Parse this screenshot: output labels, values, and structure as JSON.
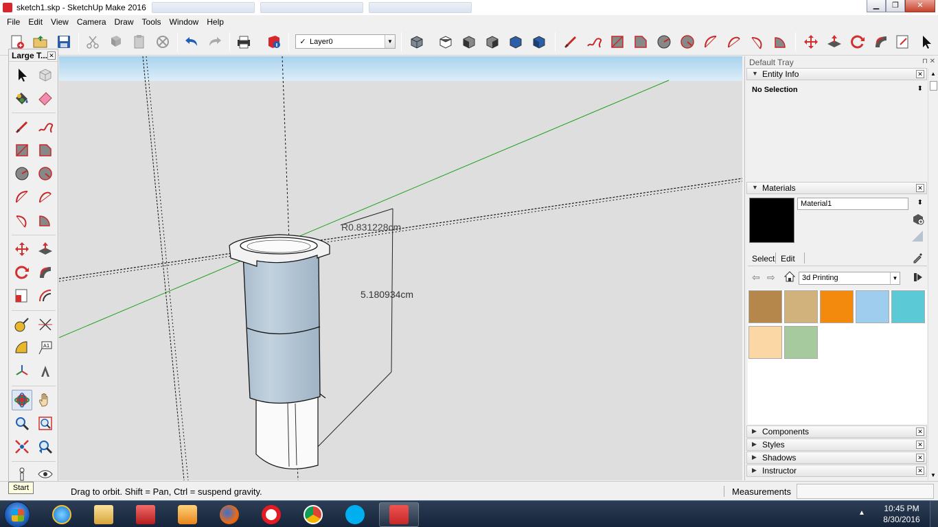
{
  "window": {
    "title": "sketch1.skp - SketchUp Make 2016",
    "buttons": {
      "minimize": "▁",
      "maximize": "❐",
      "close": "✕"
    }
  },
  "menu": [
    "File",
    "Edit",
    "View",
    "Camera",
    "Draw",
    "Tools",
    "Window",
    "Help"
  ],
  "toolbar": {
    "layer": {
      "check": "✓",
      "value": "Layer0"
    }
  },
  "palette": {
    "title": "Large T...",
    "close": "✕"
  },
  "viewport": {
    "dim_radius": "R0.831228cm",
    "dim_height": "5.180934cm",
    "colors": {
      "sky": "#cce6f7",
      "ground": "#dedede",
      "body": "#b7c7d6",
      "axis_green": "#1aa01a"
    }
  },
  "tray": {
    "title": "Default Tray",
    "pin": "⊓ ✕",
    "entity_info": {
      "label": "Entity Info",
      "selection": "No Selection"
    },
    "materials": {
      "label": "Materials",
      "name": "Material1",
      "tab_select": "Select",
      "tab_edit": "Edit",
      "library": "3d Printing",
      "swatches": [
        "#b5874b",
        "#d1b17c",
        "#f38a0e",
        "#9fcdee",
        "#5bc9d6",
        "#fbd7a6",
        "#a6c99e"
      ]
    },
    "collapsed_panels": [
      "Components",
      "Styles",
      "Shadows",
      "Instructor"
    ]
  },
  "status": {
    "hint": "Drag to orbit. Shift = Pan, Ctrl = suspend gravity.",
    "measurements_label": "Measurements",
    "tooltip": "Start"
  },
  "taskbar": {
    "time": "10:45 PM",
    "date": "8/30/2016",
    "notif": "▲"
  }
}
